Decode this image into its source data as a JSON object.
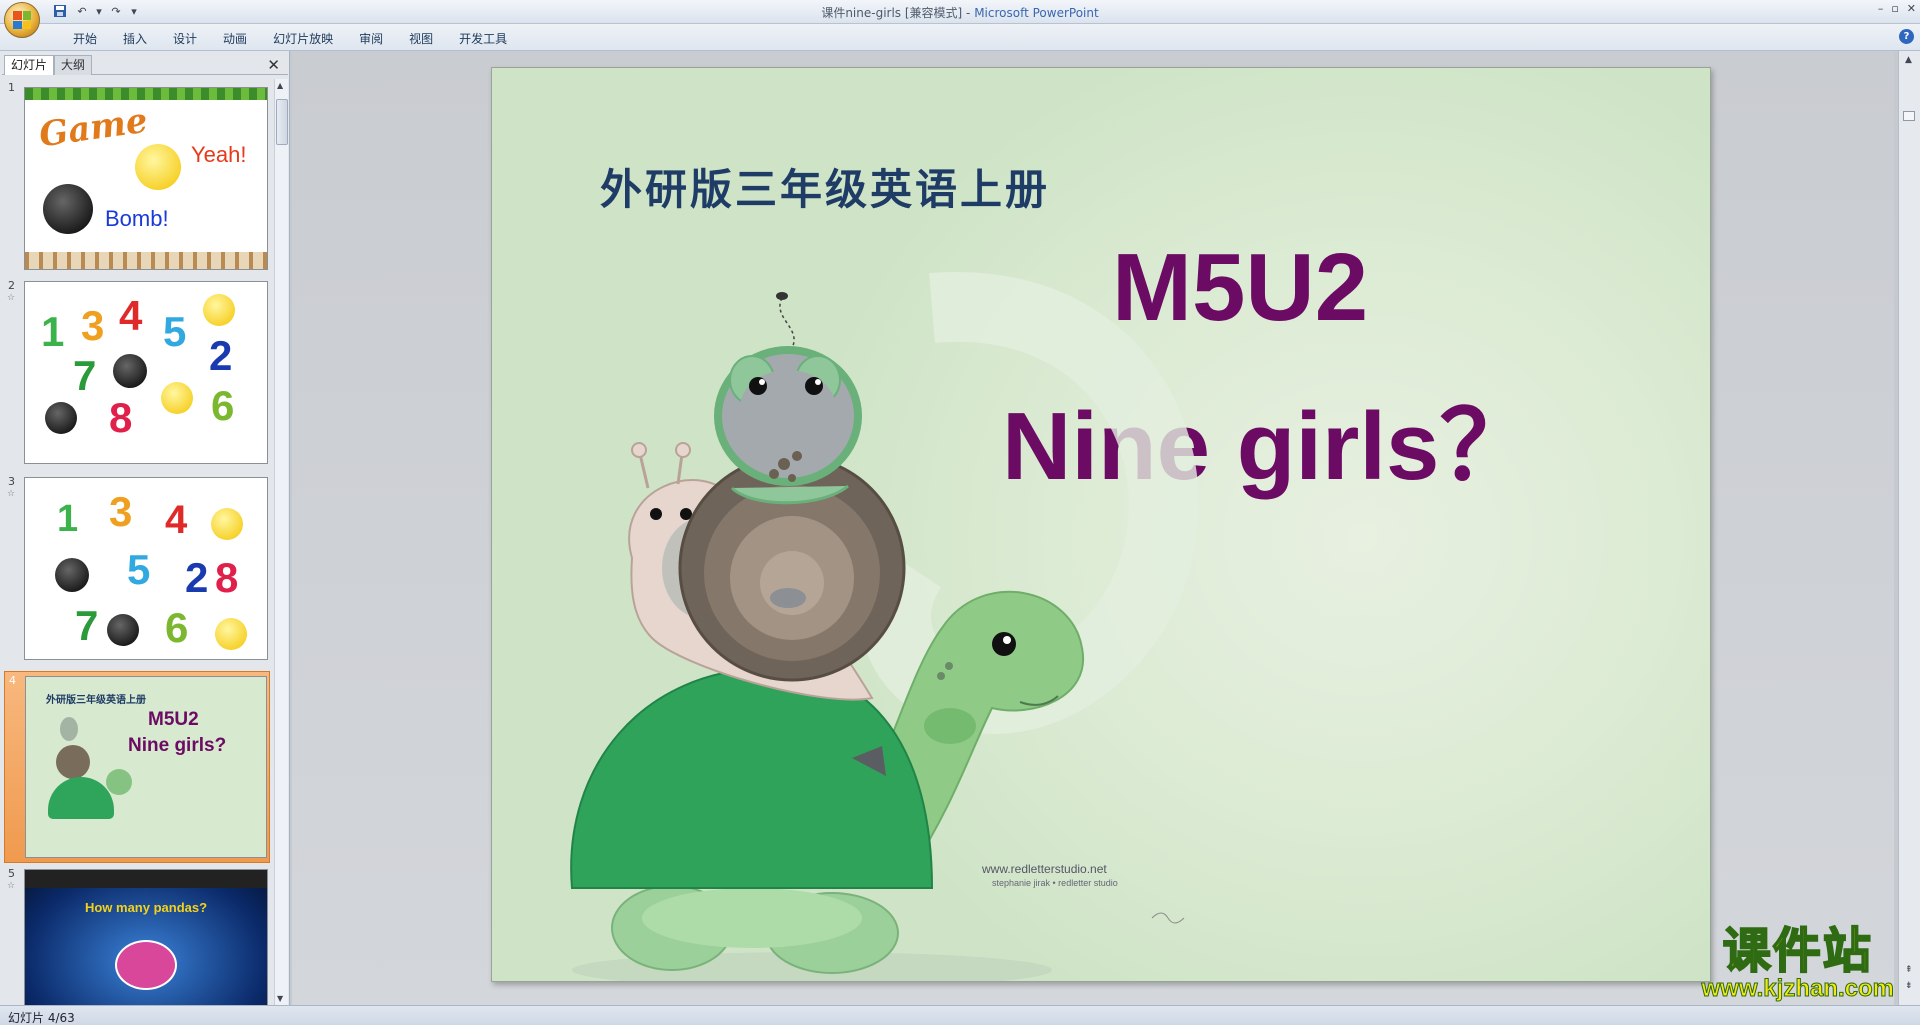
{
  "window": {
    "title_doc": "课件nine-girls [兼容模式] - ",
    "title_app": "Microsoft PowerPoint"
  },
  "ribbon": {
    "tabs": [
      "开始",
      "插入",
      "设计",
      "动画",
      "幻灯片放映",
      "审阅",
      "视图",
      "开发工具"
    ]
  },
  "pane": {
    "tab_slides": "幻灯片",
    "tab_outline": "大纲"
  },
  "thumbnails": [
    {
      "num": "1",
      "texts": {
        "game": "Game",
        "yeah": "Yeah!",
        "bomb": "Bomb!"
      }
    },
    {
      "num": "2",
      "digits": [
        "1",
        "3",
        "4",
        "5",
        "2",
        "7",
        "8",
        "6"
      ]
    },
    {
      "num": "3",
      "digits": [
        "1",
        "3",
        "4",
        "5",
        "2",
        "8",
        "7",
        "6"
      ]
    },
    {
      "num": "4",
      "subtitle": "外研版三年级英语上册",
      "title1": "M5U2",
      "title2": "Nine girls?"
    },
    {
      "num": "5",
      "text": "How many pandas?"
    }
  ],
  "slide": {
    "subtitle": "外研版三年级英语上册",
    "title1": "M5U2",
    "title2": "Nine girls？",
    "credit": "www.redletterstudio.net",
    "credit2": "stephanie jirak • redletter studio"
  },
  "watermark": {
    "main": "课件站",
    "url": "www.kjzhan.com"
  },
  "status": {
    "text": "幻灯片 4/63"
  },
  "colors": {
    "title_purple": "#6b0b63",
    "subtitle_blue": "#1f3c66",
    "selected_thumb": "#f09a4e"
  }
}
